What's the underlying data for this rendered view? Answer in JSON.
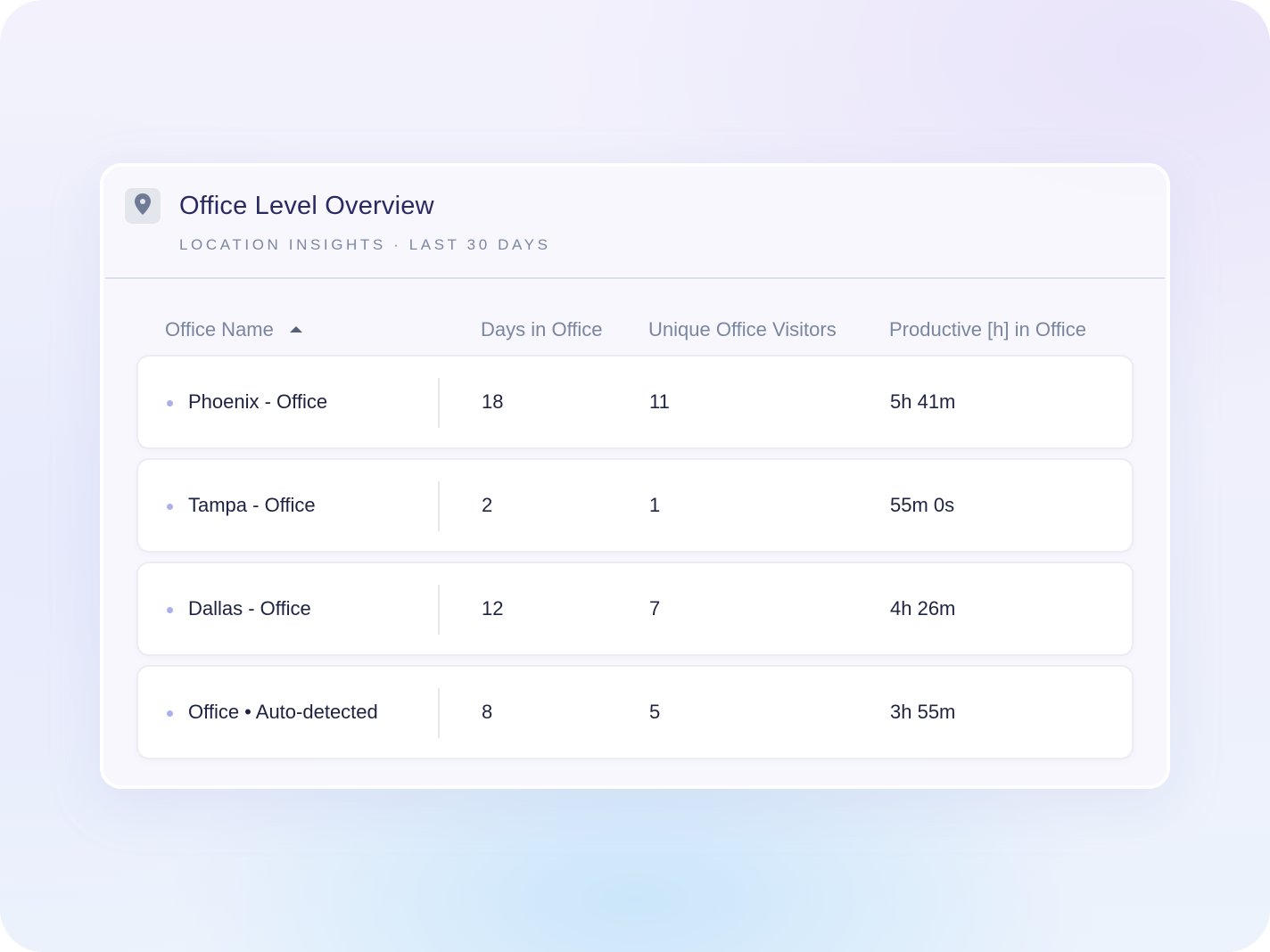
{
  "header": {
    "title": "Office Level Overview",
    "subtitle": "LOCATION INSIGHTS · LAST 30 DAYS",
    "icon": "map-pin-icon"
  },
  "table": {
    "columns": [
      {
        "label": "Office Name",
        "sorted": "ascending"
      },
      {
        "label": "Days in Office"
      },
      {
        "label": "Unique Office Visitors"
      },
      {
        "label": "Productive [h] in Office"
      }
    ],
    "rows": [
      {
        "name": "Phoenix - Office",
        "days": "18",
        "visitors": "11",
        "productive": "5h 41m"
      },
      {
        "name": "Tampa - Office",
        "days": "2",
        "visitors": "1",
        "productive": "55m 0s"
      },
      {
        "name": "Dallas - Office",
        "days": "12",
        "visitors": "7",
        "productive": "4h 26m"
      },
      {
        "name": "Office • Auto-detected",
        "days": "8",
        "visitors": "5",
        "productive": "3h 55m"
      }
    ]
  },
  "colors": {
    "title": "#2a2a63",
    "subtitle": "#7b87a3",
    "bullet": "#aab0ec"
  }
}
